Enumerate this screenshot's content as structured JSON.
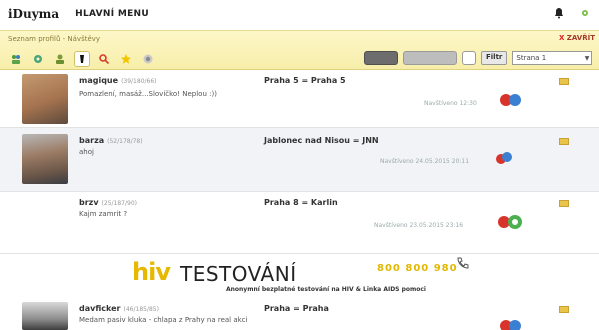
{
  "app": {
    "logo": "iDuyma",
    "menu_label": "HLAVNÍ MENU"
  },
  "header": {
    "breadcrumb": "Seznam profilů - Návštěvy",
    "close_label": "ZAVŘÍT",
    "close_x": "X",
    "filter_label": "Filtr",
    "page_select": "Strana 1"
  },
  "rows": [
    {
      "username": "magique",
      "stats": "(39/180/66)",
      "message": "Pomazlení, masáž...Slovíčko! Neplou :))",
      "location": "Praha 5 = Praha 5",
      "seen": "Navštíveno 12:30"
    },
    {
      "username": "barza",
      "stats": "(52/178/78)",
      "message": "ahoj",
      "location": "Jablonec nad Nisou = JNN",
      "seen": "Navštíveno 24.05.2015 20:11"
    },
    {
      "username": "brzv",
      "stats": "(25/187/90)",
      "message": "Kajm zamrit ?",
      "location": "Praha 8 = Karlin",
      "seen": "Navštíveno 23.05.2015 23:16"
    },
    {
      "username": "davficker",
      "stats": "(46/185/85)",
      "message": "Medam pasiv kluka - chlapa z Prahy na real akci",
      "location": "Praha = Praha",
      "seen": ""
    }
  ],
  "banner": {
    "hiv": "hiv",
    "testovani": "TESTOVÁNÍ",
    "phone": "800 800 980",
    "subtitle": "Anonymní bezplatné testování na HIV & Linka AIDS pomoci"
  },
  "colors": {
    "accent_yellow": "#f7eeaa",
    "hiv_gold": "#e6b800",
    "ribbon_red": "#c0162b"
  }
}
